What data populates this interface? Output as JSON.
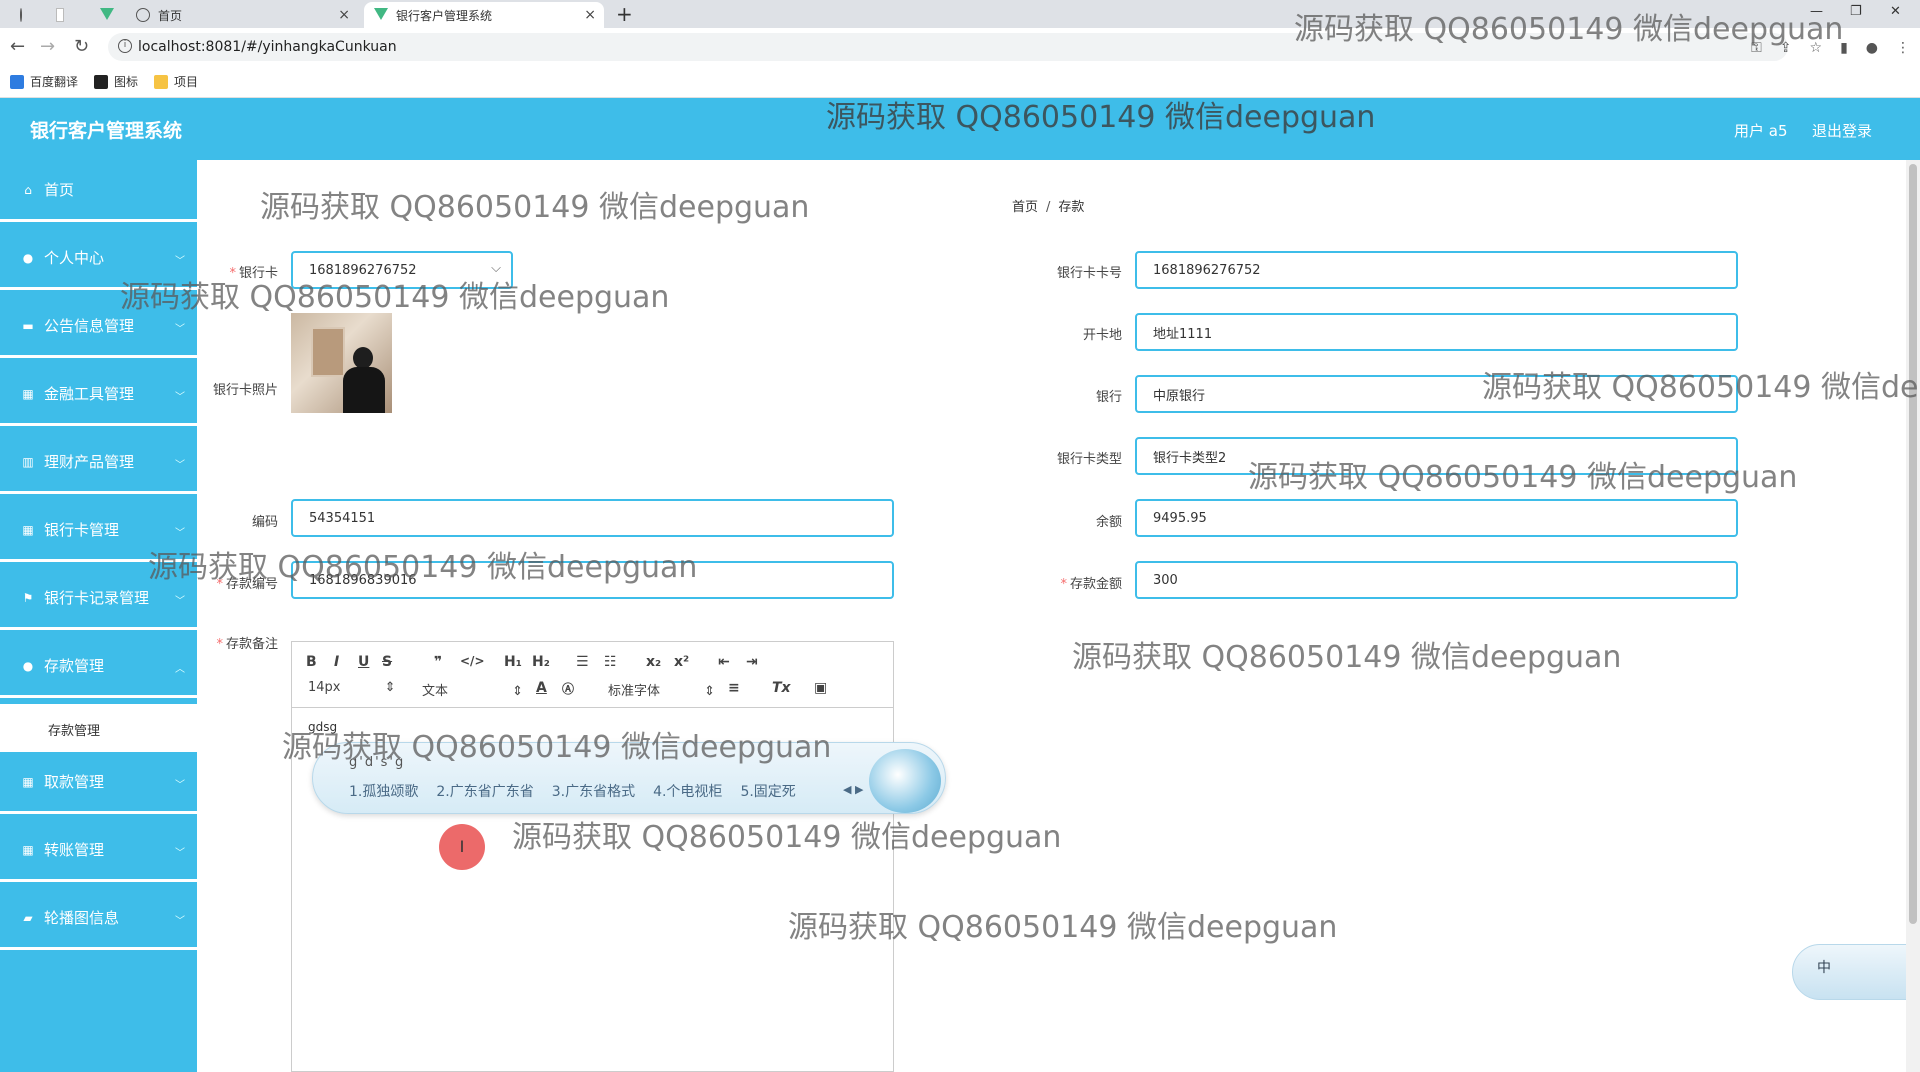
{
  "browser": {
    "tabs": [
      {
        "label": ""
      },
      {
        "label": ""
      },
      {
        "label": "首页"
      },
      {
        "label": "银行客户管理系统"
      }
    ],
    "url": "localhost:8081/#/yinhangkaCunkuan",
    "bookmarks": [
      {
        "label": "百度翻译",
        "icon": "translate-icon"
      },
      {
        "label": "图标",
        "icon": "image-icon"
      },
      {
        "label": "项目",
        "icon": "folder-icon"
      }
    ]
  },
  "header": {
    "title": "银行客户管理系统",
    "user": "用户 a5",
    "logout": "退出登录"
  },
  "sidebar": {
    "items": [
      {
        "label": "首页",
        "icon": "home-icon"
      },
      {
        "label": "个人中心",
        "icon": "user-icon"
      },
      {
        "label": "公告信息管理",
        "icon": "message-icon"
      },
      {
        "label": "金融工具管理",
        "icon": "grid-icon"
      },
      {
        "label": "理财产品管理",
        "icon": "chart-icon"
      },
      {
        "label": "银行卡管理",
        "icon": "grid-icon"
      },
      {
        "label": "银行卡记录管理",
        "icon": "flag-icon"
      },
      {
        "label": "存款管理",
        "icon": "user-icon"
      },
      {
        "label": "取款管理",
        "icon": "grid-icon"
      },
      {
        "label": "转账管理",
        "icon": "grid-icon"
      },
      {
        "label": "轮播图信息",
        "icon": "carousel-icon"
      }
    ],
    "sub_item": "存款管理"
  },
  "breadcrumb": {
    "home": "首页",
    "sep": "/",
    "current": "存款"
  },
  "form": {
    "card_label": "银行卡",
    "card_value": "1681896276752",
    "card_photo_label": "银行卡照片",
    "code_label": "编码",
    "code_value": "54354151",
    "deposit_no_label": "存款编号",
    "deposit_no_value": "1681896839016",
    "remark_label": "存款备注",
    "card_no_label": "银行卡卡号",
    "card_no_value": "1681896276752",
    "open_place_label": "开卡地",
    "open_place_value": "地址1111",
    "bank_label": "银行",
    "bank_value": "中原银行",
    "card_type_label": "银行卡类型",
    "card_type_value": "银行卡类型2",
    "balance_label": "余额",
    "balance_value": "9495.95",
    "amount_label": "存款金额",
    "amount_value": "300"
  },
  "editor": {
    "font_size": "14px",
    "block_type": "文本",
    "font_family": "标准字体",
    "content": "gdsg"
  },
  "ime": {
    "composition": "g'd's'g",
    "candidates": [
      "1.孤独颂歌",
      "2.广东省广东省",
      "3.广东省格式",
      "4.个电视柜",
      "5.固定死"
    ],
    "float_char": "中"
  },
  "watermark": "源码获取 QQ86050149 微信deepguan"
}
